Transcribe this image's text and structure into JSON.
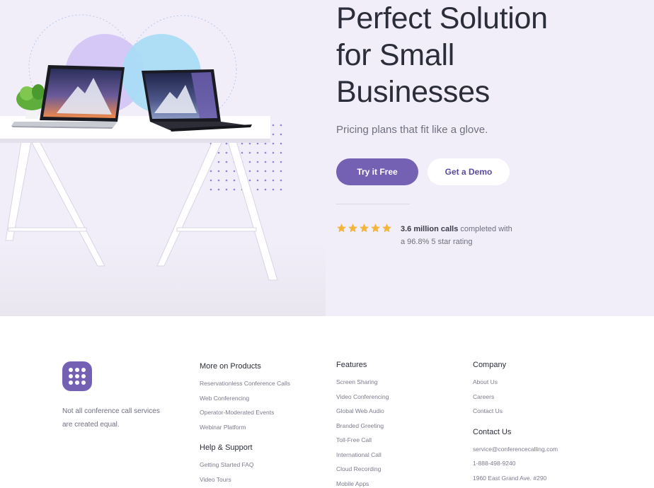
{
  "hero": {
    "title_lines": [
      "Perfect Solution",
      "for Small",
      "Businesses"
    ],
    "subtitle": "Pricing plans that fit like a glove.",
    "primary_button": "Try it Free",
    "secondary_button": "Get a Demo",
    "rating": {
      "stars": 5,
      "highlight": "3.6 million calls",
      "text_rest": " completed with",
      "line2": "a 96.8% 5 star rating"
    }
  },
  "footer": {
    "tagline": "Not all conference call services are created equal.",
    "columns": [
      {
        "heading": "More on Products",
        "links": [
          "Reservationless Conference Calls",
          "Web Conferencing",
          "Operator-Moderated Events",
          "Webinar Platform"
        ],
        "sub_heading": "Help & Support",
        "sub_links": [
          "Getting Started FAQ",
          "Video Tours"
        ]
      },
      {
        "heading": "Features",
        "links": [
          "Screen Sharing",
          "Video Conferencing",
          "Global Web Audio",
          "Branded Greeting",
          "Toll-Free Call",
          "International Call",
          "Cloud Recording",
          "Mobile Apps"
        ]
      },
      {
        "heading": "Company",
        "links": [
          "About Us",
          "Careers",
          "Contact Us"
        ],
        "sub_heading": "Contact Us",
        "sub_links": [
          "service@conferencecalling.com",
          "1-888-498-9240",
          "1960 East Grand Ave. #290"
        ]
      }
    ]
  },
  "colors": {
    "brand": "#7561b4",
    "hero_bg": "#f1eef9",
    "star": "#f5b73b",
    "circle_purple": "#d5c8f6",
    "circle_blue": "#a9dcf5"
  },
  "icons": [
    "logo-dots-icon",
    "star-icon",
    "laptop-illustration",
    "plant-illustration"
  ]
}
